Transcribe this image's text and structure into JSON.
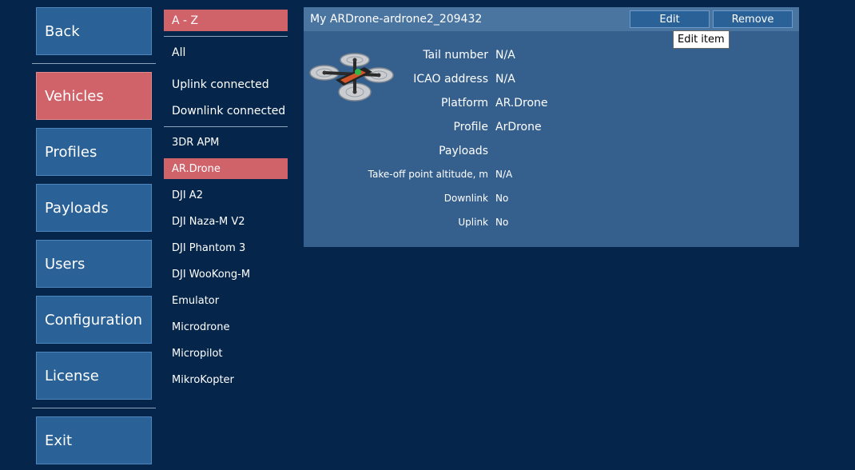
{
  "nav": {
    "back": "Back",
    "vehicles": "Vehicles",
    "profiles": "Profiles",
    "payloads": "Payloads",
    "users": "Users",
    "configuration": "Configuration",
    "license": "License",
    "exit": "Exit",
    "active": "Vehicles"
  },
  "filter": {
    "sort_label": "A - Z",
    "groups": [
      "All",
      "Uplink connected",
      "Downlink connected"
    ],
    "platforms": [
      "3DR APM",
      "AR.Drone",
      "DJI A2",
      "DJI Naza-M V2",
      "DJI Phantom 3",
      "DJI WooKong-M",
      "Emulator",
      "Microdrone",
      "Micropilot",
      "MikroKopter"
    ],
    "selected": "AR.Drone"
  },
  "vehicle": {
    "title": "My ARDrone-ardrone2_209432",
    "edit_label": "Edit",
    "remove_label": "Remove",
    "tooltip": "Edit item",
    "image_icon": "quadcopter-icon",
    "fields": [
      {
        "label": "Tail number",
        "value": "N/A"
      },
      {
        "label": "ICAO address",
        "value": "N/A"
      },
      {
        "label": "Platform",
        "value": "AR.Drone"
      },
      {
        "label": "Profile",
        "value": "ArDrone"
      },
      {
        "label": "Payloads",
        "value": ""
      },
      {
        "label": "Take-off point altitude, m",
        "value": "N/A"
      },
      {
        "label": "Downlink",
        "value": "No"
      },
      {
        "label": "Uplink",
        "value": "No"
      }
    ]
  },
  "colors": {
    "background": "#05264a",
    "button": "#2a6197",
    "accent": "#d0626a",
    "panel": "#35608d",
    "panel_header": "#4a75a1"
  }
}
